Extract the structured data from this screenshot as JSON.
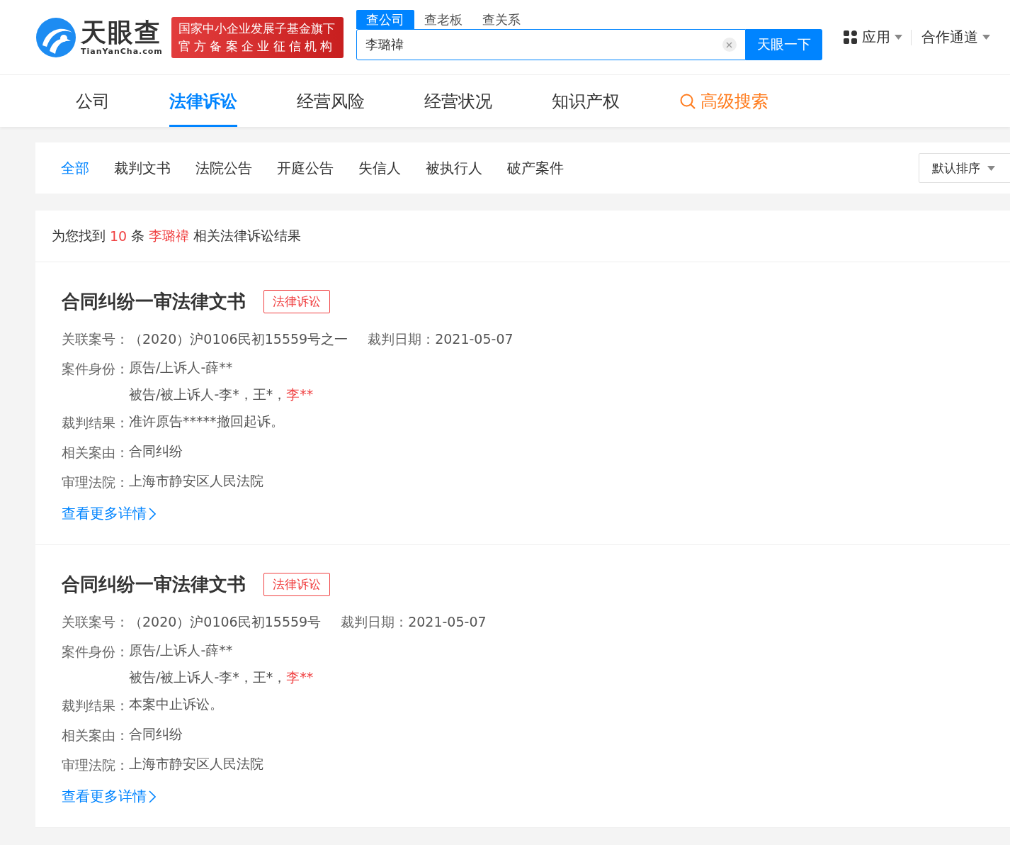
{
  "header": {
    "logo": {
      "name": "天眼查",
      "domain": "TianYanCha.com"
    },
    "badge": [
      "国家中小企业发展子基金旗下",
      "官方备案企业征信机构"
    ],
    "search_tabs": [
      {
        "label": "查公司",
        "selected": true
      },
      {
        "label": "查老板",
        "selected": false
      },
      {
        "label": "查关系",
        "selected": false
      }
    ],
    "search": {
      "value": "李璐禕",
      "button": "天眼一下"
    },
    "menu": [
      "应用",
      "合作通道"
    ]
  },
  "nav": [
    {
      "label": "公司",
      "selected": false,
      "kind": "tab"
    },
    {
      "label": "法律诉讼",
      "selected": true,
      "kind": "tab"
    },
    {
      "label": "经营风险",
      "selected": false,
      "kind": "tab"
    },
    {
      "label": "经营状况",
      "selected": false,
      "kind": "tab"
    },
    {
      "label": "知识产权",
      "selected": false,
      "kind": "tab"
    },
    {
      "label": "高级搜索",
      "selected": false,
      "kind": "search"
    }
  ],
  "filters": [
    {
      "label": "全部",
      "selected": true
    },
    {
      "label": "裁判文书",
      "selected": false
    },
    {
      "label": "法院公告",
      "selected": false
    },
    {
      "label": "开庭公告",
      "selected": false
    },
    {
      "label": "失信人",
      "selected": false
    },
    {
      "label": "被执行人",
      "selected": false
    },
    {
      "label": "破产案件",
      "selected": false
    }
  ],
  "sort": "默认排序",
  "summary": [
    {
      "text": "为您找到",
      "highlight": false
    },
    {
      "text": "10",
      "highlight": true
    },
    {
      "text": "条",
      "highlight": false
    },
    {
      "text": "李璐禕",
      "highlight": true
    },
    {
      "text": "相关法律诉讼结果",
      "highlight": false
    }
  ],
  "cases": [
    {
      "title": "合同纠纷一审法律文书",
      "tag": "法律诉讼",
      "case_no_label": "关联案号：",
      "case_no": "（2020）沪0106民初15559号之一",
      "date_label": "裁判日期：",
      "date": "2021-05-07",
      "fields": [
        {
          "label": "案件身份：",
          "lines": [
            [
              {
                "text": "原告/上诉人-薛**",
                "highlight": false
              }
            ],
            [
              {
                "text": "被告/被上诉人-李*，王*，",
                "highlight": false
              },
              {
                "text": "李**",
                "highlight": true
              }
            ]
          ]
        },
        {
          "label": "裁判结果：",
          "lines": [
            [
              {
                "text": "准许原告*****撤回起诉。",
                "highlight": false
              }
            ]
          ]
        },
        {
          "label": "相关案由：",
          "lines": [
            [
              {
                "text": "合同纠纷",
                "highlight": false
              }
            ]
          ]
        },
        {
          "label": "审理法院：",
          "lines": [
            [
              {
                "text": "上海市静安区人民法院",
                "highlight": false
              }
            ]
          ]
        }
      ],
      "link": "查看更多详情"
    },
    {
      "title": "合同纠纷一审法律文书",
      "tag": "法律诉讼",
      "case_no_label": "关联案号：",
      "case_no": "（2020）沪0106民初15559号",
      "date_label": "裁判日期：",
      "date": "2021-05-07",
      "fields": [
        {
          "label": "案件身份：",
          "lines": [
            [
              {
                "text": "原告/上诉人-薛**",
                "highlight": false
              }
            ],
            [
              {
                "text": "被告/被上诉人-李*，王*，",
                "highlight": false
              },
              {
                "text": "李**",
                "highlight": true
              }
            ]
          ]
        },
        {
          "label": "裁判结果：",
          "lines": [
            [
              {
                "text": "本案中止诉讼。",
                "highlight": false
              }
            ]
          ]
        },
        {
          "label": "相关案由：",
          "lines": [
            [
              {
                "text": "合同纠纷",
                "highlight": false
              }
            ]
          ]
        },
        {
          "label": "审理法院：",
          "lines": [
            [
              {
                "text": "上海市静安区人民法院",
                "highlight": false
              }
            ]
          ]
        }
      ],
      "link": "查看更多详情"
    }
  ]
}
